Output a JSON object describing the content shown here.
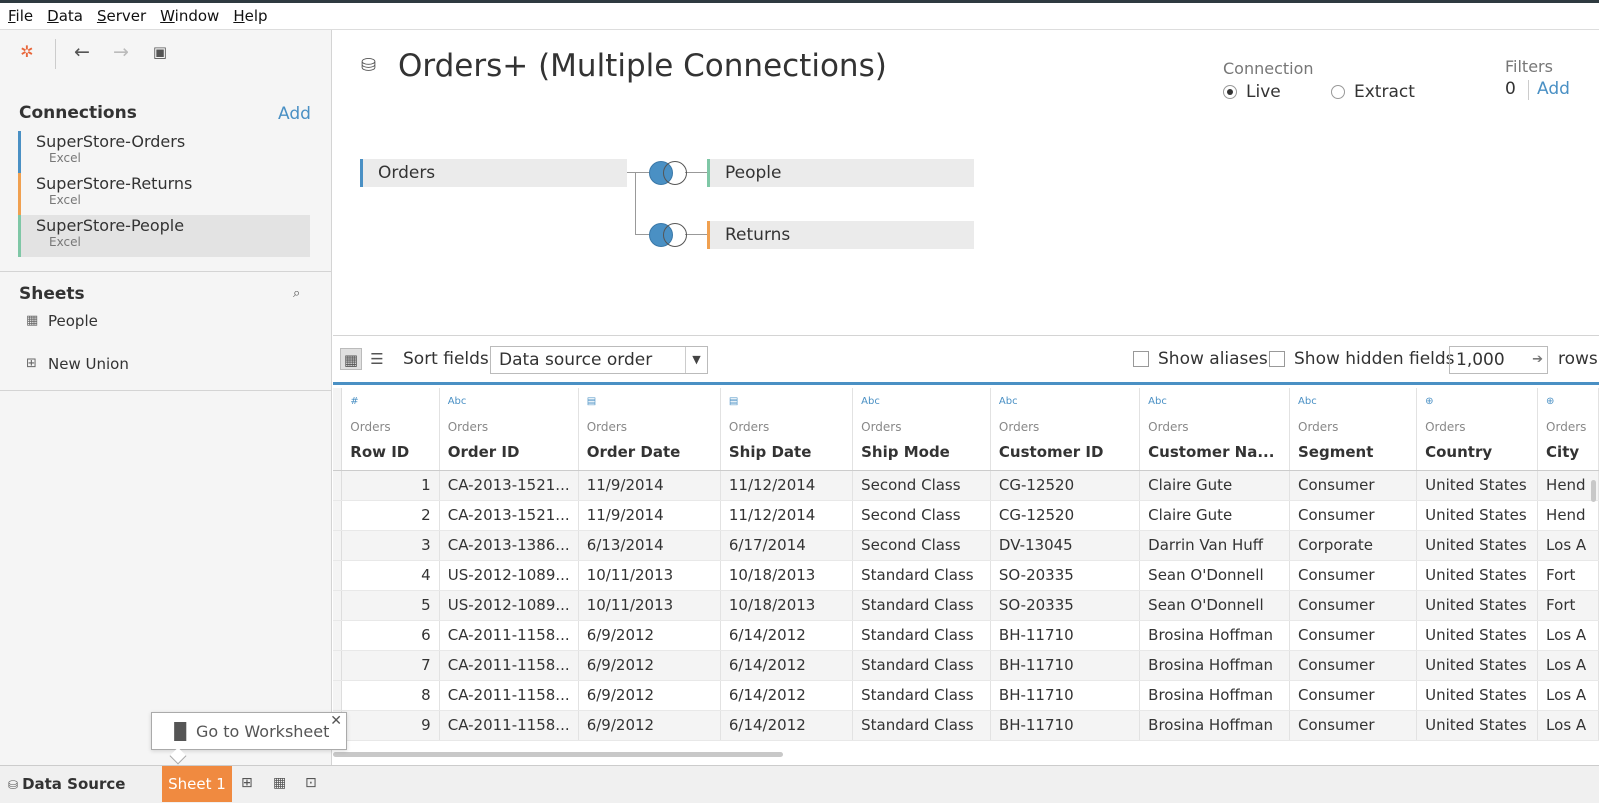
{
  "menu": [
    "File",
    "Data",
    "Server",
    "Window",
    "Help"
  ],
  "toolbar": {
    "logo_icon": "tableau-logo-icon",
    "back_icon": "arrow-left-icon",
    "forward_icon": "arrow-right-icon",
    "save_icon": "save-icon"
  },
  "connections": {
    "title": "Connections",
    "add_label": "Add",
    "items": [
      {
        "name": "SuperStore-Orders",
        "type": "Excel",
        "color": "#4a90c4"
      },
      {
        "name": "SuperStore-Returns",
        "type": "Excel",
        "color": "#f0a050"
      },
      {
        "name": "SuperStore-People",
        "type": "Excel",
        "color": "#7fc7a6"
      }
    ]
  },
  "sheets": {
    "title": "Sheets",
    "items": [
      {
        "name": "People"
      },
      {
        "name": "New Union"
      }
    ]
  },
  "datasource": {
    "title": "Orders+ (Multiple Connections)",
    "connection_label": "Connection",
    "live_label": "Live",
    "extract_label": "Extract",
    "selected_connection": "Live",
    "filters_label": "Filters",
    "filters_count": "0",
    "filters_add": "Add"
  },
  "join_canvas": {
    "primary_table": "Orders",
    "joined_tables": [
      {
        "name": "People",
        "join_type": "left"
      },
      {
        "name": "Returns",
        "join_type": "left"
      }
    ]
  },
  "grid_toolbar": {
    "sort_label": "Sort fields",
    "sort_value": "Data source order",
    "show_aliases": "Show aliases",
    "show_hidden": "Show hidden fields",
    "rows_value": "1,000",
    "rows_label": "rows"
  },
  "grid": {
    "columns": [
      {
        "type": "#",
        "source": "Orders",
        "name": "Row ID"
      },
      {
        "type": "Abc",
        "source": "Orders",
        "name": "Order ID"
      },
      {
        "type": "calendar-icon",
        "source": "Orders",
        "name": "Order Date"
      },
      {
        "type": "calendar-icon",
        "source": "Orders",
        "name": "Ship Date"
      },
      {
        "type": "Abc",
        "source": "Orders",
        "name": "Ship Mode"
      },
      {
        "type": "Abc",
        "source": "Orders",
        "name": "Customer ID"
      },
      {
        "type": "Abc",
        "source": "Orders",
        "name": "Customer Na..."
      },
      {
        "type": "Abc",
        "source": "Orders",
        "name": "Segment"
      },
      {
        "type": "globe-icon",
        "source": "Orders",
        "name": "Country"
      },
      {
        "type": "globe-icon",
        "source": "Orders",
        "name": "City"
      }
    ],
    "rows": [
      [
        "1",
        "CA-2013-1521...",
        "11/9/2014",
        "11/12/2014",
        "Second Class",
        "CG-12520",
        "Claire Gute",
        "Consumer",
        "United States",
        "Hend"
      ],
      [
        "2",
        "CA-2013-1521...",
        "11/9/2014",
        "11/12/2014",
        "Second Class",
        "CG-12520",
        "Claire Gute",
        "Consumer",
        "United States",
        "Hend"
      ],
      [
        "3",
        "CA-2013-1386...",
        "6/13/2014",
        "6/17/2014",
        "Second Class",
        "DV-13045",
        "Darrin Van Huff",
        "Corporate",
        "United States",
        "Los A"
      ],
      [
        "4",
        "US-2012-1089...",
        "10/11/2013",
        "10/18/2013",
        "Standard Class",
        "SO-20335",
        "Sean O'Donnell",
        "Consumer",
        "United States",
        "Fort"
      ],
      [
        "5",
        "US-2012-1089...",
        "10/11/2013",
        "10/18/2013",
        "Standard Class",
        "SO-20335",
        "Sean O'Donnell",
        "Consumer",
        "United States",
        "Fort"
      ],
      [
        "6",
        "CA-2011-1158...",
        "6/9/2012",
        "6/14/2012",
        "Standard Class",
        "BH-11710",
        "Brosina Hoffman",
        "Consumer",
        "United States",
        "Los A"
      ],
      [
        "7",
        "CA-2011-1158...",
        "6/9/2012",
        "6/14/2012",
        "Standard Class",
        "BH-11710",
        "Brosina Hoffman",
        "Consumer",
        "United States",
        "Los A"
      ],
      [
        "8",
        "CA-2011-1158...",
        "6/9/2012",
        "6/14/2012",
        "Standard Class",
        "BH-11710",
        "Brosina Hoffman",
        "Consumer",
        "United States",
        "Los A"
      ],
      [
        "9",
        "CA-2011-1158...",
        "6/9/2012",
        "6/14/2012",
        "Standard Class",
        "BH-11710",
        "Brosina Hoffman",
        "Consumer",
        "United States",
        "Los A"
      ]
    ]
  },
  "tooltip": {
    "text": "Go to Worksheet"
  },
  "bottom_tabs": {
    "datasource": "Data Source",
    "sheet1": "Sheet 1"
  },
  "colors": {
    "accent": "#4a90c4",
    "sheet_tab": "#f08a40"
  }
}
